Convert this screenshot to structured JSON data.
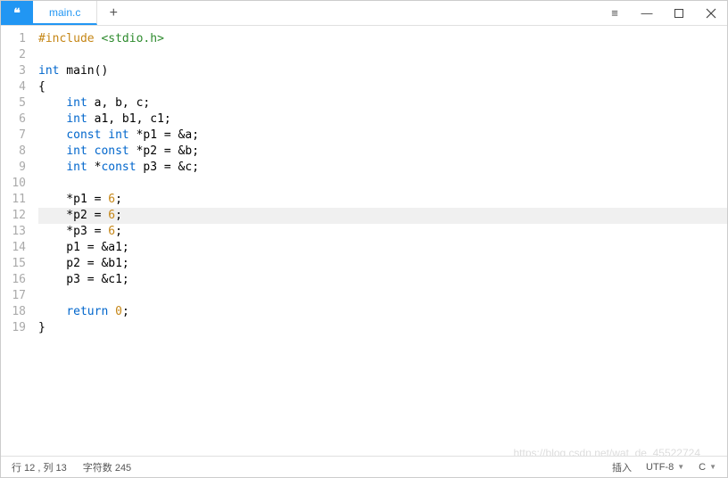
{
  "titlebar": {
    "app_icon_glyph": "❝",
    "tab_label": "main.c",
    "add_glyph": "+"
  },
  "window_controls": {
    "menu": "≡",
    "minimize": "—"
  },
  "editor": {
    "highlighted_line": 12,
    "line_count": 19,
    "tokens": [
      [
        {
          "t": "#include ",
          "c": "pp"
        },
        {
          "t": "<stdio.h>",
          "c": "inc"
        }
      ],
      [],
      [
        {
          "t": "int",
          "c": "kw"
        },
        {
          "t": " main()"
        }
      ],
      [
        {
          "t": "{"
        }
      ],
      [
        {
          "t": "    "
        },
        {
          "t": "int",
          "c": "kw"
        },
        {
          "t": " a, b, c;"
        }
      ],
      [
        {
          "t": "    "
        },
        {
          "t": "int",
          "c": "kw"
        },
        {
          "t": " a1, b1, c1;"
        }
      ],
      [
        {
          "t": "    "
        },
        {
          "t": "const",
          "c": "kw"
        },
        {
          "t": " "
        },
        {
          "t": "int",
          "c": "kw"
        },
        {
          "t": " *p1 = &a;"
        }
      ],
      [
        {
          "t": "    "
        },
        {
          "t": "int",
          "c": "kw"
        },
        {
          "t": " "
        },
        {
          "t": "const",
          "c": "kw"
        },
        {
          "t": " *p2 = &b;"
        }
      ],
      [
        {
          "t": "    "
        },
        {
          "t": "int",
          "c": "kw"
        },
        {
          "t": " *"
        },
        {
          "t": "const",
          "c": "kw"
        },
        {
          "t": " p3 = &c;"
        }
      ],
      [],
      [
        {
          "t": "    *p1 = "
        },
        {
          "t": "6",
          "c": "num"
        },
        {
          "t": ";"
        }
      ],
      [
        {
          "t": "    *p2 = "
        },
        {
          "t": "6",
          "c": "num"
        },
        {
          "t": ";"
        }
      ],
      [
        {
          "t": "    *p3 = "
        },
        {
          "t": "6",
          "c": "num"
        },
        {
          "t": ";"
        }
      ],
      [
        {
          "t": "    p1 = &a1;"
        }
      ],
      [
        {
          "t": "    p2 = &b1;"
        }
      ],
      [
        {
          "t": "    p3 = &c1;"
        }
      ],
      [],
      [
        {
          "t": "    "
        },
        {
          "t": "return",
          "c": "kw"
        },
        {
          "t": " "
        },
        {
          "t": "0",
          "c": "num"
        },
        {
          "t": ";"
        }
      ],
      [
        {
          "t": "}"
        }
      ]
    ]
  },
  "statusbar": {
    "position": "行 12 , 列 13",
    "char_count": "字符数 245",
    "insert_mode": "插入",
    "encoding": "UTF-8",
    "language": "C"
  },
  "watermark": "https://blog.csdn.net/wat_de_45522724"
}
